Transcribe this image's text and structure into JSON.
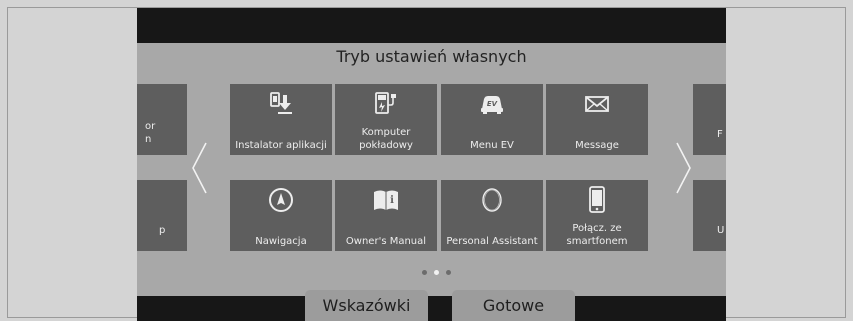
{
  "header": {
    "title": "Tryb ustawień własnych"
  },
  "tiles": [
    {
      "label": "Instalator aplikacji",
      "icon": "app-installer-icon"
    },
    {
      "label": "Komputer pokładowy",
      "icon": "trip-computer-icon"
    },
    {
      "label": "Menu EV",
      "icon": "ev-car-icon"
    },
    {
      "label": "Message",
      "icon": "envelope-icon"
    },
    {
      "label": "Nawigacja",
      "icon": "navigation-compass-icon"
    },
    {
      "label": "Owner's Manual",
      "icon": "book-icon"
    },
    {
      "label": "Personal Assistant",
      "icon": "assistant-ring-icon"
    },
    {
      "label": "Połącz. ze smartfonem",
      "icon": "smartphone-icon"
    }
  ],
  "partial_tiles": {
    "left_top": "or\nn",
    "left_bottom": "p",
    "right_top": "F",
    "right_bottom": "U"
  },
  "pager": {
    "pages": 3,
    "current": 2
  },
  "buttons": {
    "hints": "Wskazówki",
    "done": "Gotowe"
  },
  "colors": {
    "tile": "#5e5e5e",
    "panel": "#a8a8a8",
    "screen_bg": "#171717"
  }
}
